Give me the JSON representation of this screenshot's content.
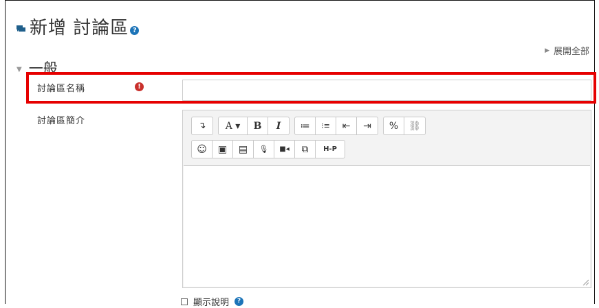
{
  "page": {
    "title": "新增 討論區",
    "help_icon": "question-icon",
    "expand_all": "展開全部"
  },
  "section": {
    "title": "一般"
  },
  "fields": {
    "forum_name": {
      "label": "討論區名稱",
      "required_icon": "!",
      "value": ""
    },
    "forum_intro": {
      "label": "討論區簡介"
    }
  },
  "toolbar": {
    "row1": [
      {
        "name": "show-more-buttons-button",
        "label": "↴"
      },
      {
        "name": "paragraph-styles-button",
        "label": "A ▾"
      },
      {
        "name": "bold-button",
        "label": "B"
      },
      {
        "name": "italic-button",
        "label": "I"
      },
      {
        "name": "unordered-list-button",
        "label": "≔"
      },
      {
        "name": "ordered-list-button",
        "label": "⁝≡"
      },
      {
        "name": "outdent-button",
        "label": "⇤"
      },
      {
        "name": "indent-button",
        "label": "⇥"
      },
      {
        "name": "link-button",
        "label": "%"
      },
      {
        "name": "unlink-button",
        "label": "⛓"
      }
    ],
    "row2": [
      {
        "name": "emoji-button",
        "label": "☺"
      },
      {
        "name": "image-button",
        "label": "▣"
      },
      {
        "name": "media-button",
        "label": "▤"
      },
      {
        "name": "record-audio-button",
        "label": "🎙"
      },
      {
        "name": "record-video-button",
        "label": "■◂"
      },
      {
        "name": "manage-files-button",
        "label": "⧉"
      },
      {
        "name": "h5p-button",
        "label": "H-P"
      }
    ]
  },
  "display_description": {
    "label": "顯示說明",
    "checked": false
  },
  "colors": {
    "highlight": "#e60000",
    "help_blue": "#1c74b8",
    "required_red": "#c9302c"
  }
}
